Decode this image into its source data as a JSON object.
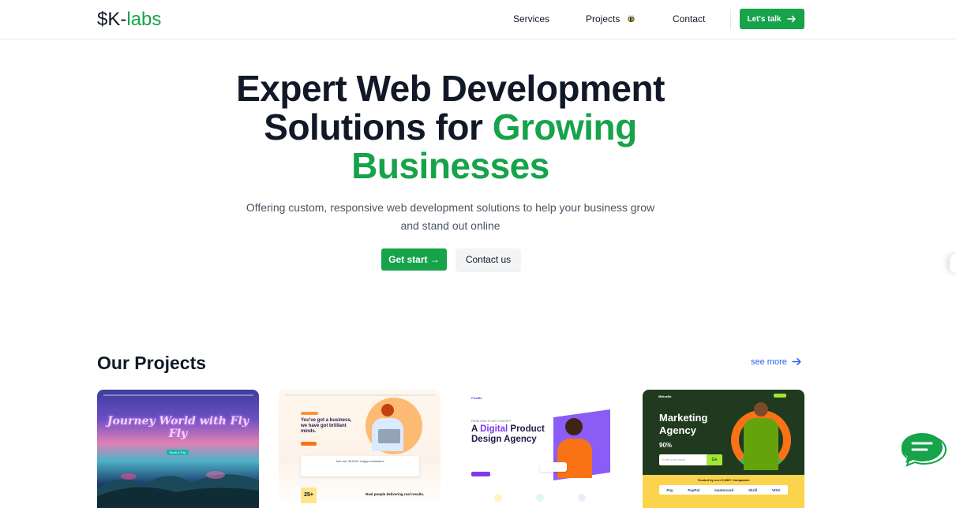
{
  "brand": {
    "part1": "$K-",
    "part2": "labs"
  },
  "nav": {
    "services": "Services",
    "projects": "Projects",
    "contact": "Contact",
    "cta": "Let's talk"
  },
  "hero": {
    "line1": "Expert Web Development",
    "line2a": "Solutions for ",
    "line2b": "Growing",
    "line3": "Businesses",
    "subtitle": "Offering custom, responsive web development solutions to help your business grow and stand out online",
    "primary_btn": "Get start →",
    "secondary_btn": "Contact us"
  },
  "projects": {
    "title": "Our Projects",
    "see_more": "see more",
    "cards": [
      {
        "heading": "Journey World with Fly Fly",
        "button": "Book a Trip"
      },
      {
        "heading": "You've got a business, we have got brilliant minds.",
        "badge": "25+",
        "strip": "Join our 30,000+ happy customers",
        "caption": "Real people delivering real results."
      },
      {
        "brand": "PostBe",
        "kicker": "FROM IDEA TO ART CONCEPT",
        "heading_a": "A ",
        "heading_b": "Digital",
        "heading_c": " Product Design Agency"
      },
      {
        "brand": "Mkkrafts",
        "heading": "Marketing Agency",
        "stat": "90%",
        "input": "Enter your email",
        "button": "Go",
        "trusted": "Trusted by over 5,000+ Companies",
        "logos": [
          "Pay",
          "PayPal",
          "mastercard",
          "Skrill",
          "VISA"
        ]
      }
    ]
  },
  "colors": {
    "accent": "#16a34a",
    "dark": "#111827",
    "link": "#2563eb"
  },
  "icons": {
    "arrow": "arrow-right-icon",
    "bee": "bee-icon",
    "chat": "chat-icon"
  }
}
